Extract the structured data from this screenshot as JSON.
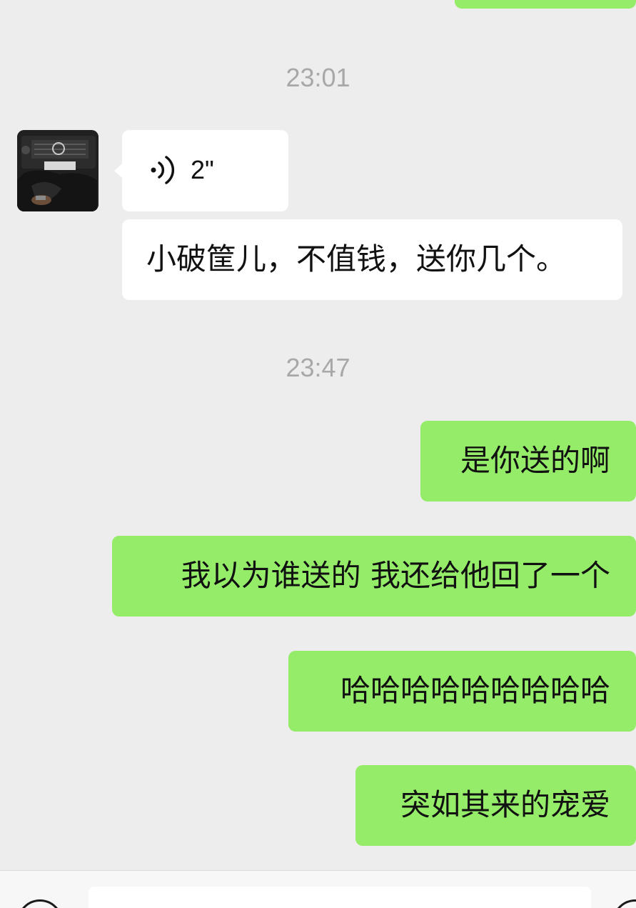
{
  "chat": {
    "timestamps": [
      "23:01",
      "23:47"
    ],
    "incoming": {
      "avatar_icon": "avatar-image",
      "voice_message": {
        "icon": "voice-waves-icon",
        "duration": "2\""
      },
      "text_message": "小破筐儿，不值钱，送你几个。"
    },
    "outgoing_messages": [
      "是你送的啊",
      "我以为谁送的 我还给他回了一个",
      "哈哈哈哈哈哈哈哈哈",
      "突如其来的宠爱"
    ]
  },
  "input_bar": {
    "left_icon": "voice-toggle-icon",
    "right_icon": "emoji-icon"
  },
  "colors": {
    "background": "#ededed",
    "outgoing_bubble": "#95ec69",
    "incoming_bubble": "#ffffff",
    "timestamp_text": "#a8a8a8"
  }
}
